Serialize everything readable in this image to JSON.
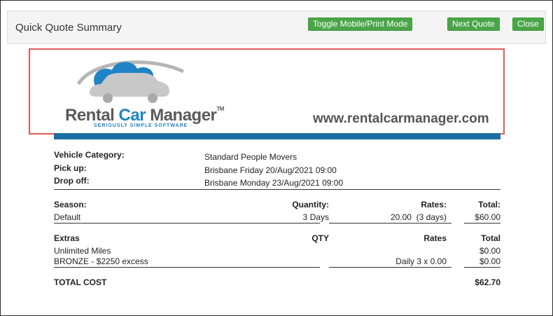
{
  "header": {
    "title": "Quick Quote Summary",
    "toggle_label": "Toggle Mobile/Print Mode",
    "next_label": "Next Quote",
    "close_label": "Close"
  },
  "banner": {
    "logo_word1": "Rental ",
    "logo_word2": "Car ",
    "logo_word3": "Manager",
    "logo_tm": "TM",
    "tagline": "SERIOUSLY SIMPLE SOFTWARE",
    "website": "www.rentalcarmanager.com",
    "colors": {
      "accent_blue": "#1f83c6",
      "bar_blue": "#1b6ea2",
      "highlight_red": "#e05a5a"
    }
  },
  "vehicle": {
    "category_label": "Vehicle Category:",
    "category_value": "Standard People Movers",
    "pickup_label": "Pick up:",
    "pickup_value": "Brisbane Friday 20/Aug/2021 09:00",
    "dropoff_label": "Drop off:",
    "dropoff_value": "Brisbane Monday 23/Aug/2021 09:00"
  },
  "season_table": {
    "headers": {
      "season": "Season:",
      "quantity": "Quantity:",
      "rates": "Rates:",
      "total": "Total:"
    },
    "row": {
      "season": "Default",
      "quantity": "3 Days",
      "rates": "20.00  (3 days)",
      "total": "$60.00"
    }
  },
  "extras_table": {
    "headers": {
      "extras": "Extras",
      "qty": "QTY",
      "rates": "Rates",
      "total": "Total"
    },
    "rows": [
      {
        "name": "Unlimited Miles",
        "rates": "",
        "total": "$0.00"
      },
      {
        "name": "BRONZE - $2250 excess",
        "rates": "Daily 3 x 0.00",
        "total": "$0.00"
      }
    ]
  },
  "total": {
    "label": "TOTAL COST",
    "value": "$62.70"
  }
}
